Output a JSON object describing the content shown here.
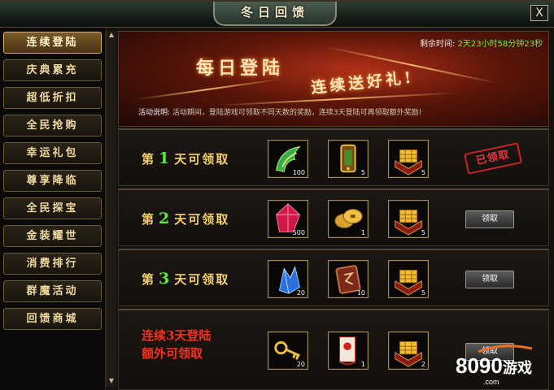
{
  "window": {
    "title": "冬日回馈",
    "close_label": "X"
  },
  "sidebar": {
    "items": [
      {
        "label": "连续登陆",
        "active": true
      },
      {
        "label": "庆典累充"
      },
      {
        "label": "超低折扣"
      },
      {
        "label": "全民抢购"
      },
      {
        "label": "幸运礼包"
      },
      {
        "label": "尊享降临"
      },
      {
        "label": "全民探宝"
      },
      {
        "label": "金装耀世"
      },
      {
        "label": "消费排行"
      },
      {
        "label": "群魔活动"
      },
      {
        "label": "回馈商城"
      }
    ]
  },
  "banner": {
    "title_part1": "每日登陆",
    "title_part2": "连续送好礼!",
    "timer_label": "剩余时间:",
    "timer_value": "2天23小时58分钟23秒",
    "desc_label": "活动说明:",
    "desc_text": "活动期间，登陆游戏可领取不同天数的奖励，连续3天登陆可再领取额外奖励!"
  },
  "rows": [
    {
      "prefix": "第",
      "day": "1",
      "suffix": "天可领取",
      "items": [
        {
          "icon": "jade-wing-icon",
          "qty": "100"
        },
        {
          "icon": "gold-talisman-icon",
          "qty": "5"
        },
        {
          "icon": "gold-chest-icon",
          "qty": "5"
        }
      ],
      "status": "claimed",
      "stamp_label": "已领取"
    },
    {
      "prefix": "第",
      "day": "2",
      "suffix": "天可领取",
      "items": [
        {
          "icon": "red-gem-icon",
          "qty": "500"
        },
        {
          "icon": "gold-coin-icon",
          "qty": "1"
        },
        {
          "icon": "gold-chest-icon",
          "qty": "5"
        }
      ],
      "status": "available",
      "button_label": "领取"
    },
    {
      "prefix": "第",
      "day": "3",
      "suffix": "天可领取",
      "items": [
        {
          "icon": "blue-crystal-icon",
          "qty": "20"
        },
        {
          "icon": "rune-tablet-icon",
          "qty": "10"
        },
        {
          "icon": "gold-chest-icon",
          "qty": "5"
        }
      ],
      "status": "available",
      "button_label": "领取"
    },
    {
      "label_line1": "连续3天登陆",
      "label_line2": "额外可领取",
      "items": [
        {
          "icon": "golden-key-icon",
          "qty": "20"
        },
        {
          "icon": "red-scroll-icon",
          "qty": "1"
        },
        {
          "icon": "gold-chest-icon",
          "qty": "2"
        }
      ],
      "status": "available",
      "button_label": "领取"
    }
  ],
  "watermark": {
    "digits": "8090",
    "brand": "游戏",
    "domain": ".com"
  },
  "colors": {
    "accent": "#f4cf6a",
    "day_number": "#5ee83c",
    "timer": "#6ef03a",
    "extra_label": "#f0341e",
    "stamp": "#c8242a"
  }
}
